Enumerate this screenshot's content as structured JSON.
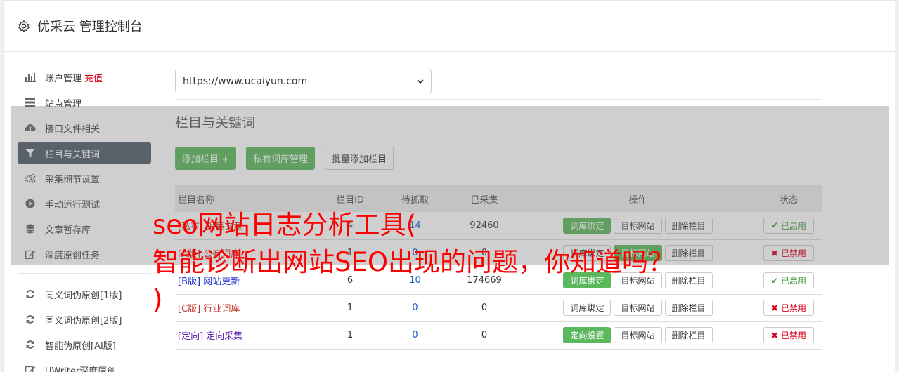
{
  "header": {
    "title": "优采云 管理控制台"
  },
  "sidebar": {
    "items": [
      {
        "label": "账户管理",
        "extra": "充值"
      },
      {
        "label": "站点管理"
      },
      {
        "label": "接口文件相关"
      },
      {
        "label": "栏目与关键词"
      },
      {
        "label": "采集细节设置"
      },
      {
        "label": "手动运行测试"
      },
      {
        "label": "文章暂存库"
      },
      {
        "label": "深度原创任务"
      },
      {
        "label": "同义词伪原创[1版]"
      },
      {
        "label": "同义词伪原创[2版]"
      },
      {
        "label": "智能伪原创[AI版]"
      },
      {
        "label": "UWriter深度原创"
      }
    ]
  },
  "site_select": {
    "value": "https://www.ucaiyun.com"
  },
  "section": {
    "title": "栏目与关键词"
  },
  "toolbar": {
    "add": "添加栏目 +",
    "private_lib": "私有词库管理",
    "batch_add": "批量添加栏目"
  },
  "table": {
    "headers": [
      "栏目名称",
      "栏目ID",
      "待抓取",
      "已采集",
      "操作",
      "状态"
    ],
    "rows": [
      {
        "tag": "[私有]",
        "name": "采集文章",
        "id": "4",
        "pending": "14",
        "done": "92460",
        "op1": "词库绑定",
        "op2": "目标网站",
        "op3": "删除栏目",
        "status": "已启用"
      },
      {
        "tag": "[A版]",
        "name": "公有词库",
        "id": "1",
        "pending": "0",
        "done": "0",
        "op1": "词库绑定",
        "op2": "目标网站",
        "op3": "删除栏目",
        "status": "已禁用"
      },
      {
        "tag": "[B版]",
        "name": "网站更新",
        "id": "6",
        "pending": "10",
        "done": "174669",
        "op1": "词库绑定",
        "op2": "目标网站",
        "op3": "删除栏目",
        "status": "已启用"
      },
      {
        "tag": "[C版]",
        "name": "行业词库",
        "id": "1",
        "pending": "0",
        "done": "0",
        "op1": "词库绑定",
        "op2": "目标网站",
        "op3": "删除栏目",
        "status": "已禁用"
      },
      {
        "tag": "[定向]",
        "name": "定向采集",
        "id": "1",
        "pending": "0",
        "done": "0",
        "op1": "定向设置",
        "op2": "目标网站",
        "op3": "删除栏目",
        "status": "已禁用"
      }
    ]
  },
  "promo": {
    "line1": "seo网站日志分析工具(",
    "line2": "智能诊断出网站SEO出现的问题，你知道吗？",
    "line3": ")"
  }
}
